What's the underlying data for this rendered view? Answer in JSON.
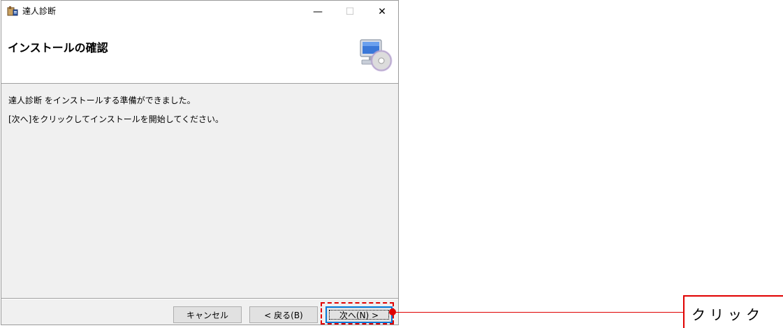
{
  "window": {
    "title": "達人診断",
    "minimize_glyph": "—",
    "maximize_glyph": "☐",
    "close_glyph": "✕"
  },
  "header": {
    "title": "インストールの確認",
    "graphic_icon": "computer-cd-icon"
  },
  "body": {
    "line1": "達人診断 をインストールする準備ができました。",
    "line2": "[次へ]をクリックしてインストールを開始してください。"
  },
  "footer": {
    "cancel_label": "キャンセル",
    "back_label": "< 戻る(B)",
    "next_label": "次へ(N) >"
  },
  "annotation": {
    "callout_text": "クリック",
    "color": "#e00000"
  }
}
